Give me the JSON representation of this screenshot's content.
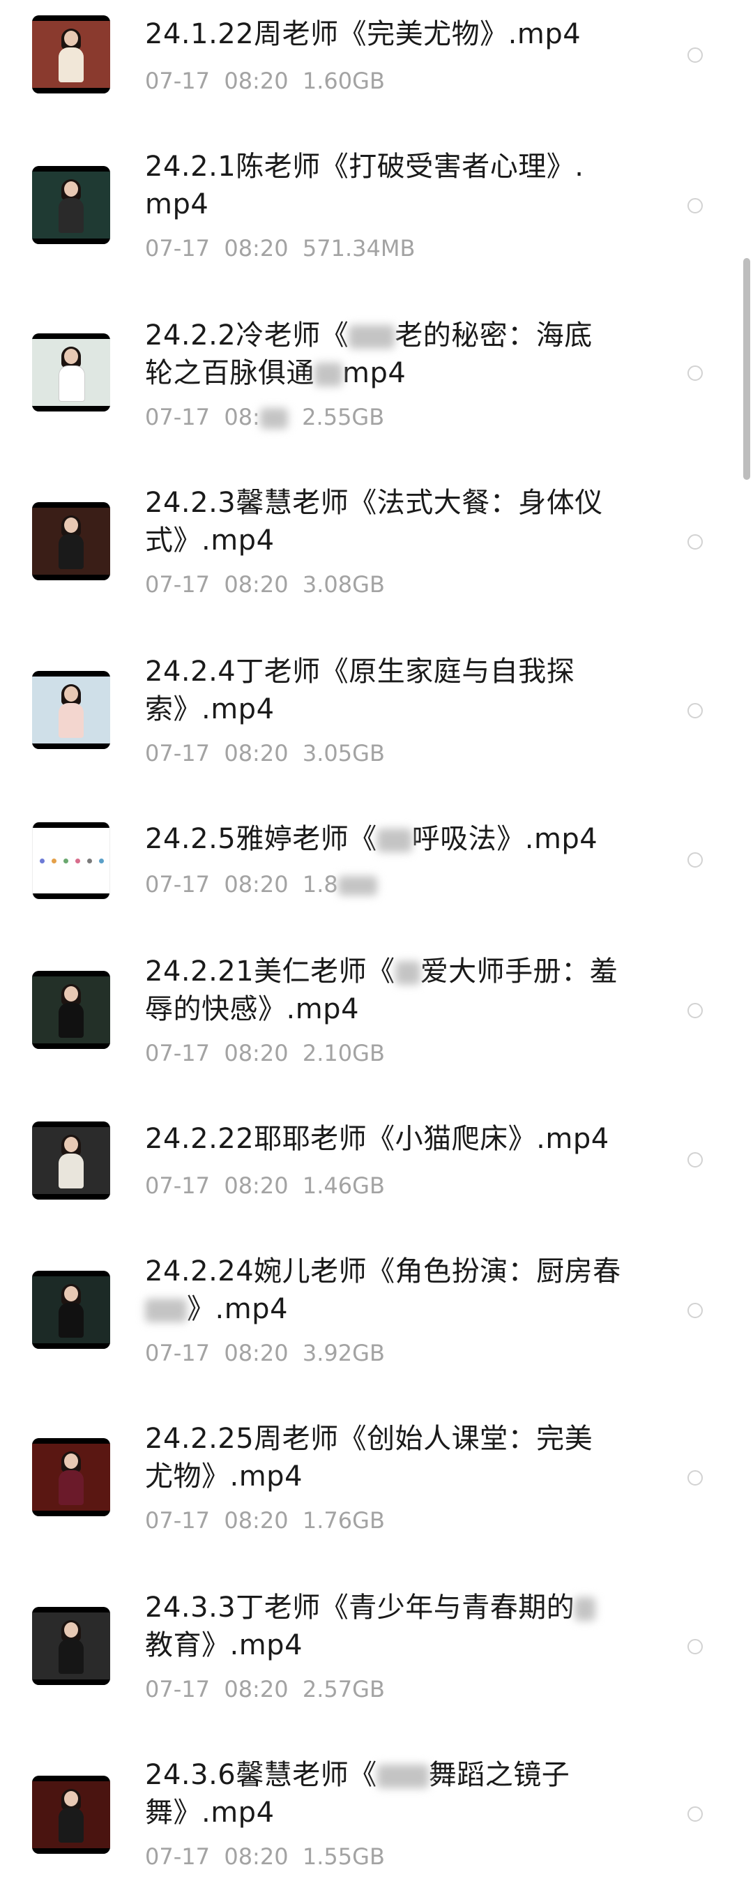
{
  "files": [
    {
      "title": "24.1.22周老师《完美尤物》.mp4",
      "date": "07-17",
      "time": "08:20",
      "size": "1.60GB",
      "thumb_bg": "#8a3a2e",
      "thumb_outfit": "#f1e7d8"
    },
    {
      "title": "24.2.1陈老师《打破受害者心理》.mp4",
      "date": "07-17",
      "time": "08:20",
      "size": "571.34MB",
      "thumb_bg": "#1f3a33",
      "thumb_outfit": "#2a2a2a"
    },
    {
      "title": "24.2.2冷老师《",
      "title_after": "老的秘密：海底轮之百脉俱通",
      "title_end": "mp4",
      "date": "07-17",
      "time": "08:",
      "size": "2.55GB",
      "thumb_bg": "#dfe7e2",
      "thumb_outfit": "#ffffff"
    },
    {
      "title": "24.2.3馨慧老师《法式大餐：身体仪式》.mp4",
      "date": "07-17",
      "time": "08:20",
      "size": "3.08GB",
      "thumb_bg": "#3a1e17",
      "thumb_outfit": "#1a1a1a"
    },
    {
      "title": "24.2.4丁老师《原生家庭与自我探索》.mp4",
      "date": "07-17",
      "time": "08:20",
      "size": "3.05GB",
      "thumb_bg": "#cfdfe8",
      "thumb_outfit": "#f3d6cf"
    },
    {
      "title": "24.2.5雅婷老师《",
      "title_after": "呼吸法》.mp4",
      "date": "07-17",
      "time": "08:20",
      "size": "1.8",
      "thumb_bg": "#ffffff",
      "thumb_outfit": "#ffffff"
    },
    {
      "title": "24.2.21美仁老师《",
      "title_after": "爱大师手册：羞辱的快感》.mp4",
      "date": "07-17",
      "time": "08:20",
      "size": "2.10GB",
      "thumb_bg": "#233028",
      "thumb_outfit": "#111111"
    },
    {
      "title": "24.2.22耶耶老师《小猫爬床》.mp4",
      "date": "07-17",
      "time": "08:20",
      "size": "1.46GB",
      "thumb_bg": "#2b2b2b",
      "thumb_outfit": "#e9e5dc"
    },
    {
      "title": "24.2.24婉儿老师《角色扮演：厨房春",
      "title_after": "》.mp4",
      "date": "07-17",
      "time": "08:20",
      "size": "3.92GB",
      "thumb_bg": "#1c2a26",
      "thumb_outfit": "#111111"
    },
    {
      "title": "24.2.25周老师《创始人课堂：完美尤物》.mp4",
      "date": "07-17",
      "time": "08:20",
      "size": "1.76GB",
      "thumb_bg": "#5a1712",
      "thumb_outfit": "#6b1a2a"
    },
    {
      "title": "24.3.3丁老师《青少年与青春期的",
      "title_after": "教育》.mp4",
      "date": "07-17",
      "time": "08:20",
      "size": "2.57GB",
      "thumb_bg": "#2a2a2a",
      "thumb_outfit": "#161616"
    },
    {
      "title": "24.3.6馨慧老师《",
      "title_after": "舞蹈之镜子舞》.mp4",
      "date": "07-17",
      "time": "08:20",
      "size": "1.55GB",
      "thumb_bg": "#4a1410",
      "thumb_outfit": "#1a1a1a"
    }
  ],
  "colors": {
    "title_text": "#1a1a1a",
    "meta_text": "#a3a3a3",
    "radio_border": "#d2d2d2",
    "scrollbar": "#bdbdbd",
    "slide_dots": [
      "#6d7bd6",
      "#e4a04a",
      "#6aa86f",
      "#d86d8c",
      "#7a7a7a",
      "#5aa0c8"
    ]
  },
  "icons": {
    "select": "radio-circle-icon"
  }
}
